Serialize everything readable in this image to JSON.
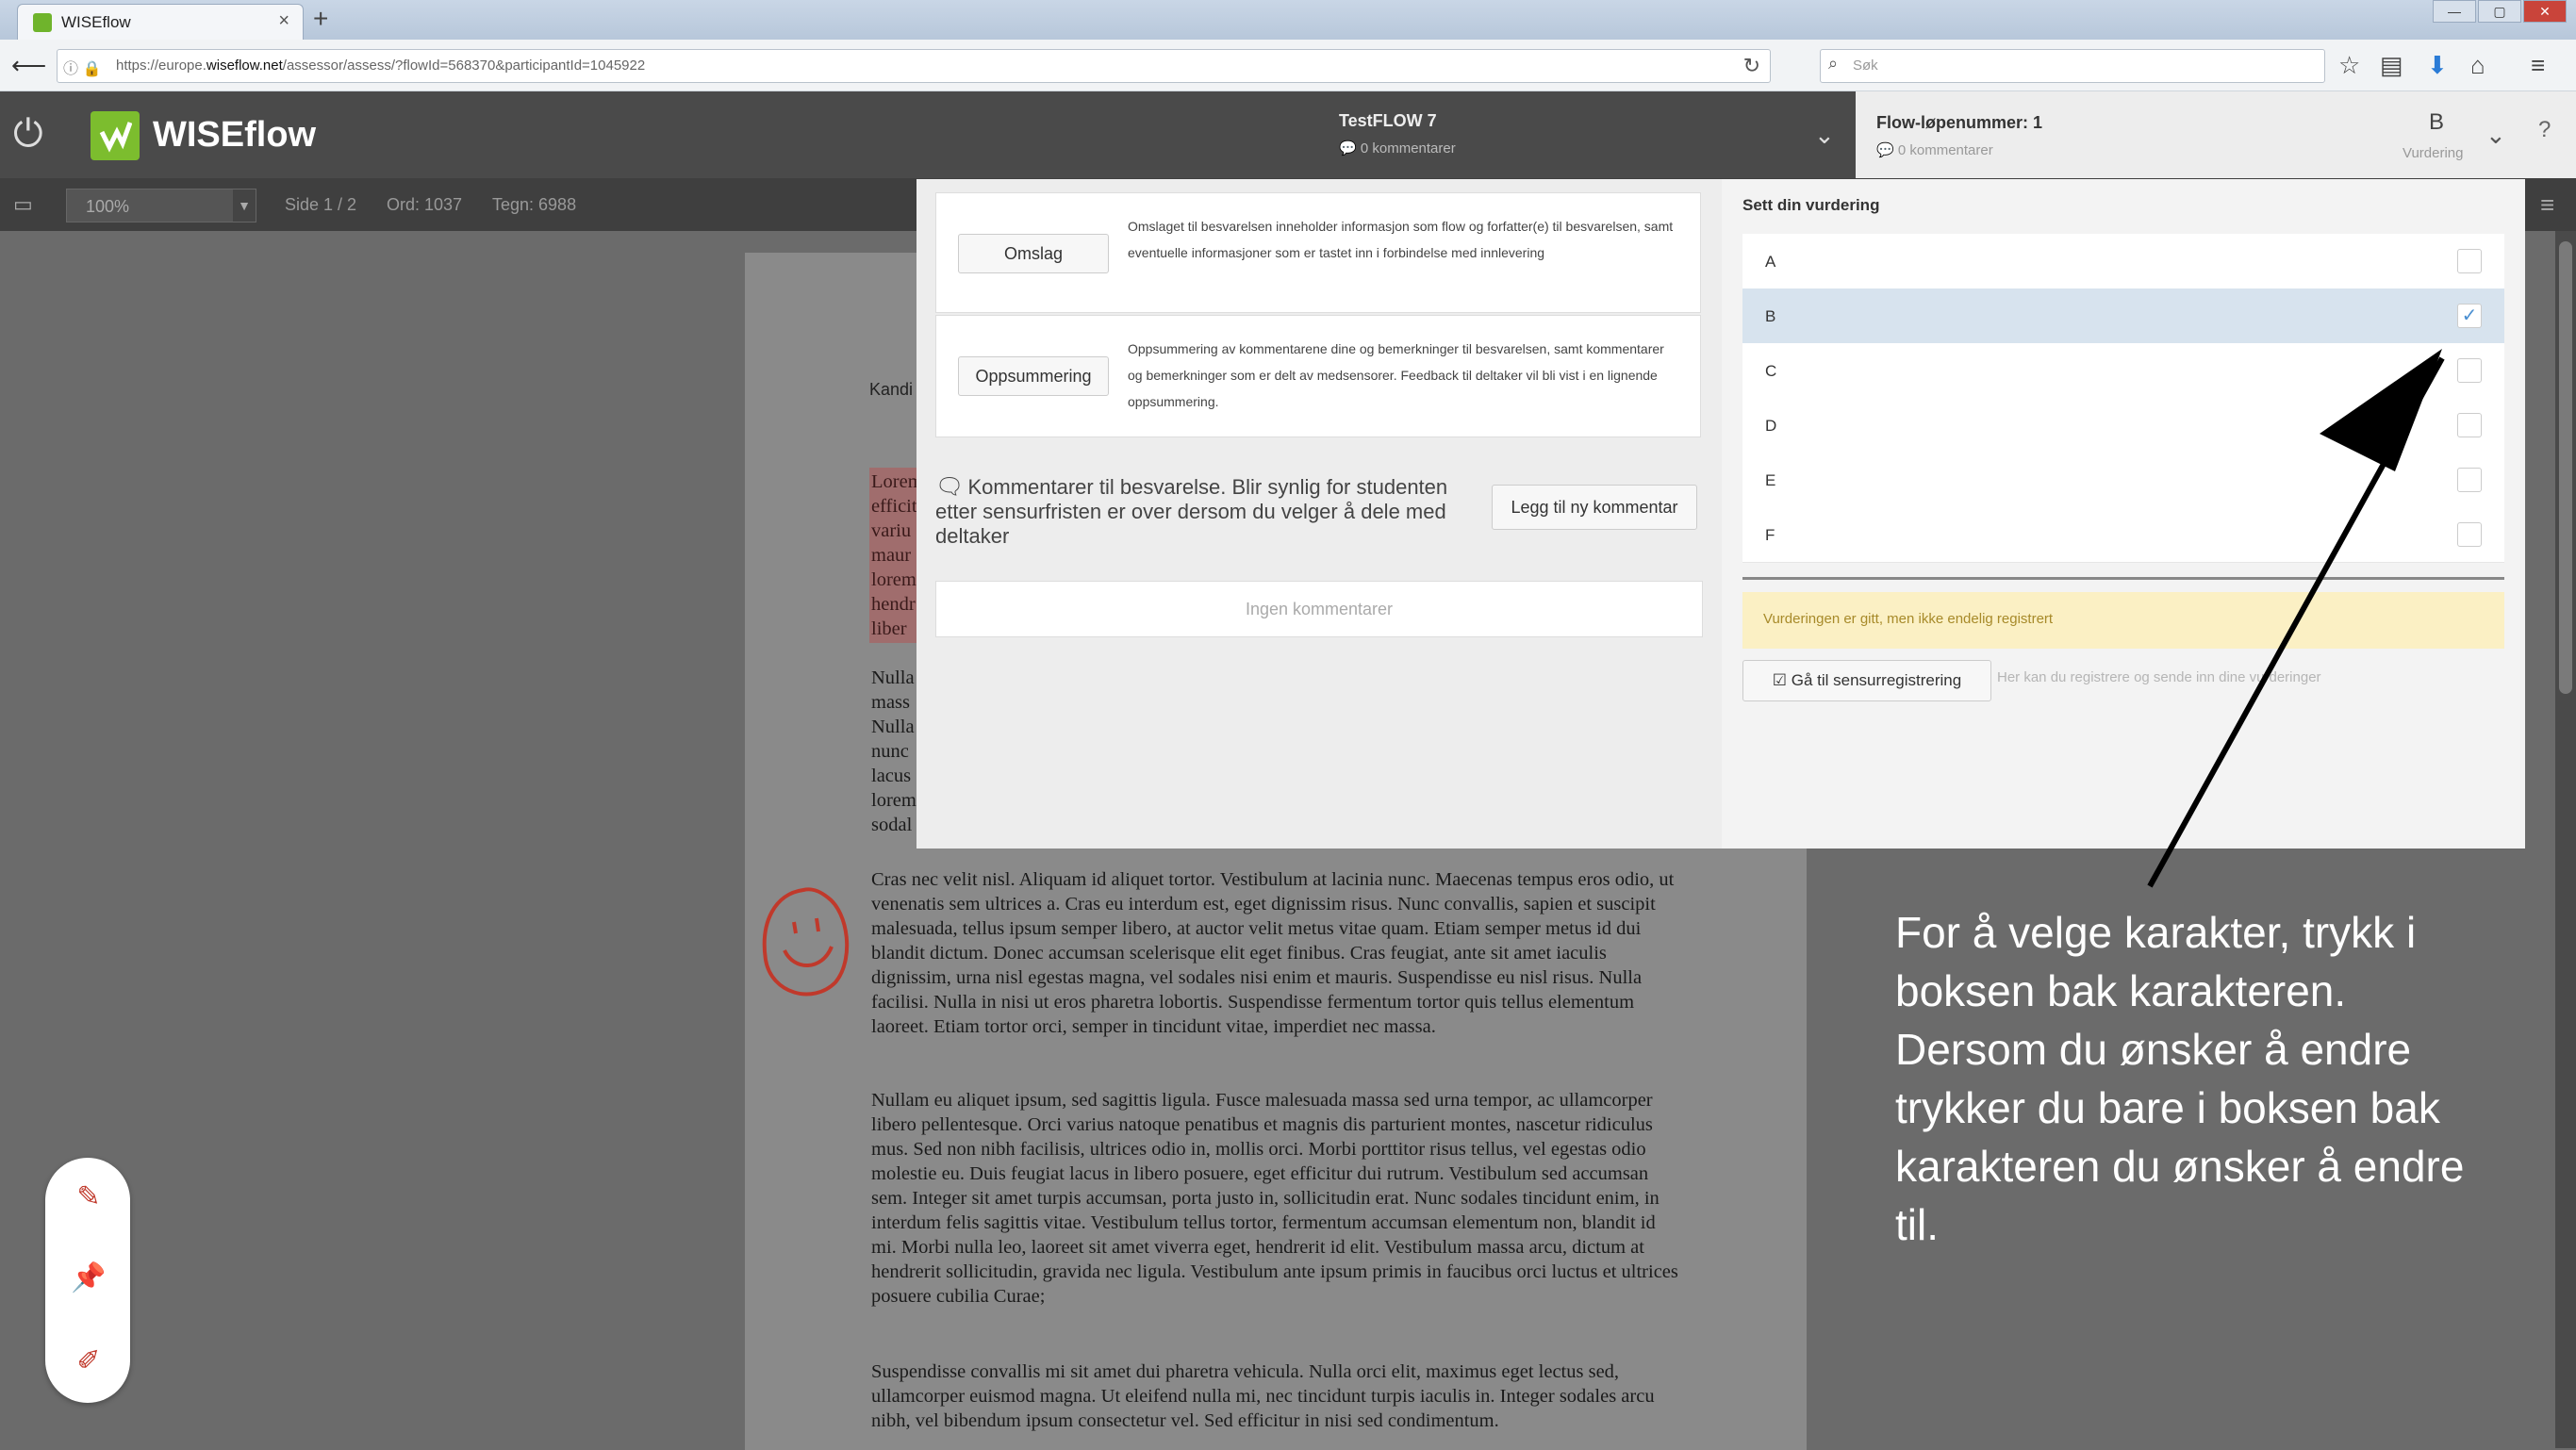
{
  "browser": {
    "tab_title": "WISEflow",
    "tab_close": "×",
    "new_tab": "+",
    "window_buttons": [
      "—",
      "▢",
      "✕"
    ],
    "url_prefix": "https://europe.",
    "url_domain": "wiseflow.net",
    "url_path": "/assessor/assess/?flowId=568370&participantId=1045922",
    "search_placeholder": "Søk"
  },
  "app": {
    "brand": "WISEflow",
    "flow_title": "TestFLOW 7",
    "flow_comments": "0 kommentarer",
    "flow_number_label": "Flow-løpenummer: 1",
    "flow_number_comments": "0 kommentarer",
    "current_grade": "B",
    "grade_label": "Vurdering"
  },
  "toolbar": {
    "zoom": "100%",
    "page": "Side 1 / 2",
    "words": "Ord: 1037",
    "chars": "Tegn: 6988"
  },
  "modal": {
    "cover_button": "Omslag",
    "cover_desc": "Omslaget til besvarelsen inneholder informasjon som flow og forfatter(e) til besvarelsen, samt eventuelle informasjoner som er tastet inn i forbindelse med innlevering",
    "summary_button": "Oppsummering",
    "summary_desc": "Oppsummering av kommentarene dine og bemerkninger til besvarelsen, samt kommentarer og bemerkninger som er delt av medsensorer. Feedback til deltaker vil bli vist i en lignende oppsummering.",
    "comments_heading": "Kommentarer til besvarelse. Blir synlig for studenten etter sensurfristen er over dersom du velger å dele med deltaker",
    "add_comment": "Legg til ny kommentar",
    "no_comments": "Ingen kommentarer",
    "grade_heading": "Sett din vurdering",
    "grades": [
      "A",
      "B",
      "C",
      "D",
      "E",
      "F"
    ],
    "selected_grade_index": 1,
    "warning": "Vurderingen er gitt, men ikke endelig registrert",
    "go_button": "Gå til sensurregistrering",
    "go_hint": "Her kan du registrere og sende inn dine vurderinger"
  },
  "document": {
    "candidate_label": "Kandi",
    "left_fragment_1": "Lorem\nefficit\nvariu\nmaur\nlorem\nhendr\nliber",
    "left_fragment_2": "Nulla\nmass\nNulla\nnunc\nlacus\nlorem\nsodal",
    "para1": "Cras nec velit nisl. Aliquam id aliquet tortor. Vestibulum at lacinia nunc. Maecenas tempus eros odio, ut venenatis sem ultrices a. Cras eu interdum est, eget dignissim risus. Nunc convallis, sapien et suscipit malesuada, tellus ipsum semper libero, at auctor velit metus vitae quam. Etiam semper metus id dui blandit dictum. Donec accumsan scelerisque elit eget finibus. Cras feugiat, ante sit amet iaculis dignissim, urna nisl egestas magna, vel sodales nisi enim et mauris. Suspendisse eu nisl risus. Nulla facilisi. Nulla in nisi ut eros pharetra lobortis. Suspendisse fermentum tortor quis tellus elementum laoreet. Etiam tortor orci, semper in tincidunt vitae, imperdiet nec massa.",
    "para2": "Nullam eu aliquet ipsum, sed sagittis ligula. Fusce malesuada massa sed urna tempor, ac ullamcorper libero pellentesque. Orci varius natoque penatibus et magnis dis parturient montes, nascetur ridiculus mus. Sed non nibh facilisis, ultrices odio in, mollis orci. Morbi porttitor risus tellus, vel egestas odio molestie eu. Duis feugiat lacus in libero posuere, eget efficitur dui rutrum. Vestibulum sed accumsan sem. Integer sit amet turpis accumsan, porta justo in, sollicitudin erat. Nunc sodales tincidunt enim, in interdum felis sagittis vitae. Vestibulum tellus tortor, fermentum accumsan elementum non, blandit id mi. Morbi nulla leo, laoreet sit amet viverra eget, hendrerit id elit. Vestibulum massa arcu, dictum at hendrerit sollicitudin, gravida nec ligula. Vestibulum ante ipsum primis in faucibus orci luctus et ultrices posuere cubilia Curae;",
    "para3": "Suspendisse convallis mi sit amet dui pharetra vehicula. Nulla orci elit, maximus eget lectus sed, ullamcorper euismod magna. Ut eleifend nulla mi, nec tincidunt turpis iaculis in. Integer sodales arcu nibh, vel bibendum ipsum consectetur vel. Sed efficitur in nisi sed condimentum."
  },
  "caption": "For å velge karakter, trykk i boksen bak karakteren. Dersom du ønsker å endre trykker du bare i boksen bak karakteren du ønsker å endre til.",
  "icons": {
    "back": "back-arrow-icon",
    "power": "power-icon",
    "pen": "pen-icon",
    "pin": "pin-icon",
    "erase": "eraser-icon"
  },
  "colors": {
    "brand_green": "#7cbd2e",
    "header_dark": "#4a4a4a",
    "selected_row": "#d7e3ee",
    "warning_bg": "#fbf0c4",
    "annotation_red": "#c0392b"
  }
}
